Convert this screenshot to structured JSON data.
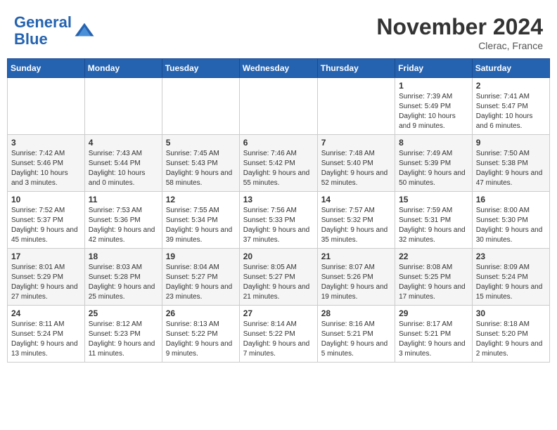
{
  "header": {
    "logo_line1": "General",
    "logo_line2": "Blue",
    "month": "November 2024",
    "location": "Clerac, France"
  },
  "weekdays": [
    "Sunday",
    "Monday",
    "Tuesday",
    "Wednesday",
    "Thursday",
    "Friday",
    "Saturday"
  ],
  "weeks": [
    [
      {
        "day": "",
        "info": ""
      },
      {
        "day": "",
        "info": ""
      },
      {
        "day": "",
        "info": ""
      },
      {
        "day": "",
        "info": ""
      },
      {
        "day": "",
        "info": ""
      },
      {
        "day": "1",
        "info": "Sunrise: 7:39 AM\nSunset: 5:49 PM\nDaylight: 10 hours and 9 minutes."
      },
      {
        "day": "2",
        "info": "Sunrise: 7:41 AM\nSunset: 5:47 PM\nDaylight: 10 hours and 6 minutes."
      }
    ],
    [
      {
        "day": "3",
        "info": "Sunrise: 7:42 AM\nSunset: 5:46 PM\nDaylight: 10 hours and 3 minutes."
      },
      {
        "day": "4",
        "info": "Sunrise: 7:43 AM\nSunset: 5:44 PM\nDaylight: 10 hours and 0 minutes."
      },
      {
        "day": "5",
        "info": "Sunrise: 7:45 AM\nSunset: 5:43 PM\nDaylight: 9 hours and 58 minutes."
      },
      {
        "day": "6",
        "info": "Sunrise: 7:46 AM\nSunset: 5:42 PM\nDaylight: 9 hours and 55 minutes."
      },
      {
        "day": "7",
        "info": "Sunrise: 7:48 AM\nSunset: 5:40 PM\nDaylight: 9 hours and 52 minutes."
      },
      {
        "day": "8",
        "info": "Sunrise: 7:49 AM\nSunset: 5:39 PM\nDaylight: 9 hours and 50 minutes."
      },
      {
        "day": "9",
        "info": "Sunrise: 7:50 AM\nSunset: 5:38 PM\nDaylight: 9 hours and 47 minutes."
      }
    ],
    [
      {
        "day": "10",
        "info": "Sunrise: 7:52 AM\nSunset: 5:37 PM\nDaylight: 9 hours and 45 minutes."
      },
      {
        "day": "11",
        "info": "Sunrise: 7:53 AM\nSunset: 5:36 PM\nDaylight: 9 hours and 42 minutes."
      },
      {
        "day": "12",
        "info": "Sunrise: 7:55 AM\nSunset: 5:34 PM\nDaylight: 9 hours and 39 minutes."
      },
      {
        "day": "13",
        "info": "Sunrise: 7:56 AM\nSunset: 5:33 PM\nDaylight: 9 hours and 37 minutes."
      },
      {
        "day": "14",
        "info": "Sunrise: 7:57 AM\nSunset: 5:32 PM\nDaylight: 9 hours and 35 minutes."
      },
      {
        "day": "15",
        "info": "Sunrise: 7:59 AM\nSunset: 5:31 PM\nDaylight: 9 hours and 32 minutes."
      },
      {
        "day": "16",
        "info": "Sunrise: 8:00 AM\nSunset: 5:30 PM\nDaylight: 9 hours and 30 minutes."
      }
    ],
    [
      {
        "day": "17",
        "info": "Sunrise: 8:01 AM\nSunset: 5:29 PM\nDaylight: 9 hours and 27 minutes."
      },
      {
        "day": "18",
        "info": "Sunrise: 8:03 AM\nSunset: 5:28 PM\nDaylight: 9 hours and 25 minutes."
      },
      {
        "day": "19",
        "info": "Sunrise: 8:04 AM\nSunset: 5:27 PM\nDaylight: 9 hours and 23 minutes."
      },
      {
        "day": "20",
        "info": "Sunrise: 8:05 AM\nSunset: 5:27 PM\nDaylight: 9 hours and 21 minutes."
      },
      {
        "day": "21",
        "info": "Sunrise: 8:07 AM\nSunset: 5:26 PM\nDaylight: 9 hours and 19 minutes."
      },
      {
        "day": "22",
        "info": "Sunrise: 8:08 AM\nSunset: 5:25 PM\nDaylight: 9 hours and 17 minutes."
      },
      {
        "day": "23",
        "info": "Sunrise: 8:09 AM\nSunset: 5:24 PM\nDaylight: 9 hours and 15 minutes."
      }
    ],
    [
      {
        "day": "24",
        "info": "Sunrise: 8:11 AM\nSunset: 5:24 PM\nDaylight: 9 hours and 13 minutes."
      },
      {
        "day": "25",
        "info": "Sunrise: 8:12 AM\nSunset: 5:23 PM\nDaylight: 9 hours and 11 minutes."
      },
      {
        "day": "26",
        "info": "Sunrise: 8:13 AM\nSunset: 5:22 PM\nDaylight: 9 hours and 9 minutes."
      },
      {
        "day": "27",
        "info": "Sunrise: 8:14 AM\nSunset: 5:22 PM\nDaylight: 9 hours and 7 minutes."
      },
      {
        "day": "28",
        "info": "Sunrise: 8:16 AM\nSunset: 5:21 PM\nDaylight: 9 hours and 5 minutes."
      },
      {
        "day": "29",
        "info": "Sunrise: 8:17 AM\nSunset: 5:21 PM\nDaylight: 9 hours and 3 minutes."
      },
      {
        "day": "30",
        "info": "Sunrise: 8:18 AM\nSunset: 5:20 PM\nDaylight: 9 hours and 2 minutes."
      }
    ]
  ]
}
